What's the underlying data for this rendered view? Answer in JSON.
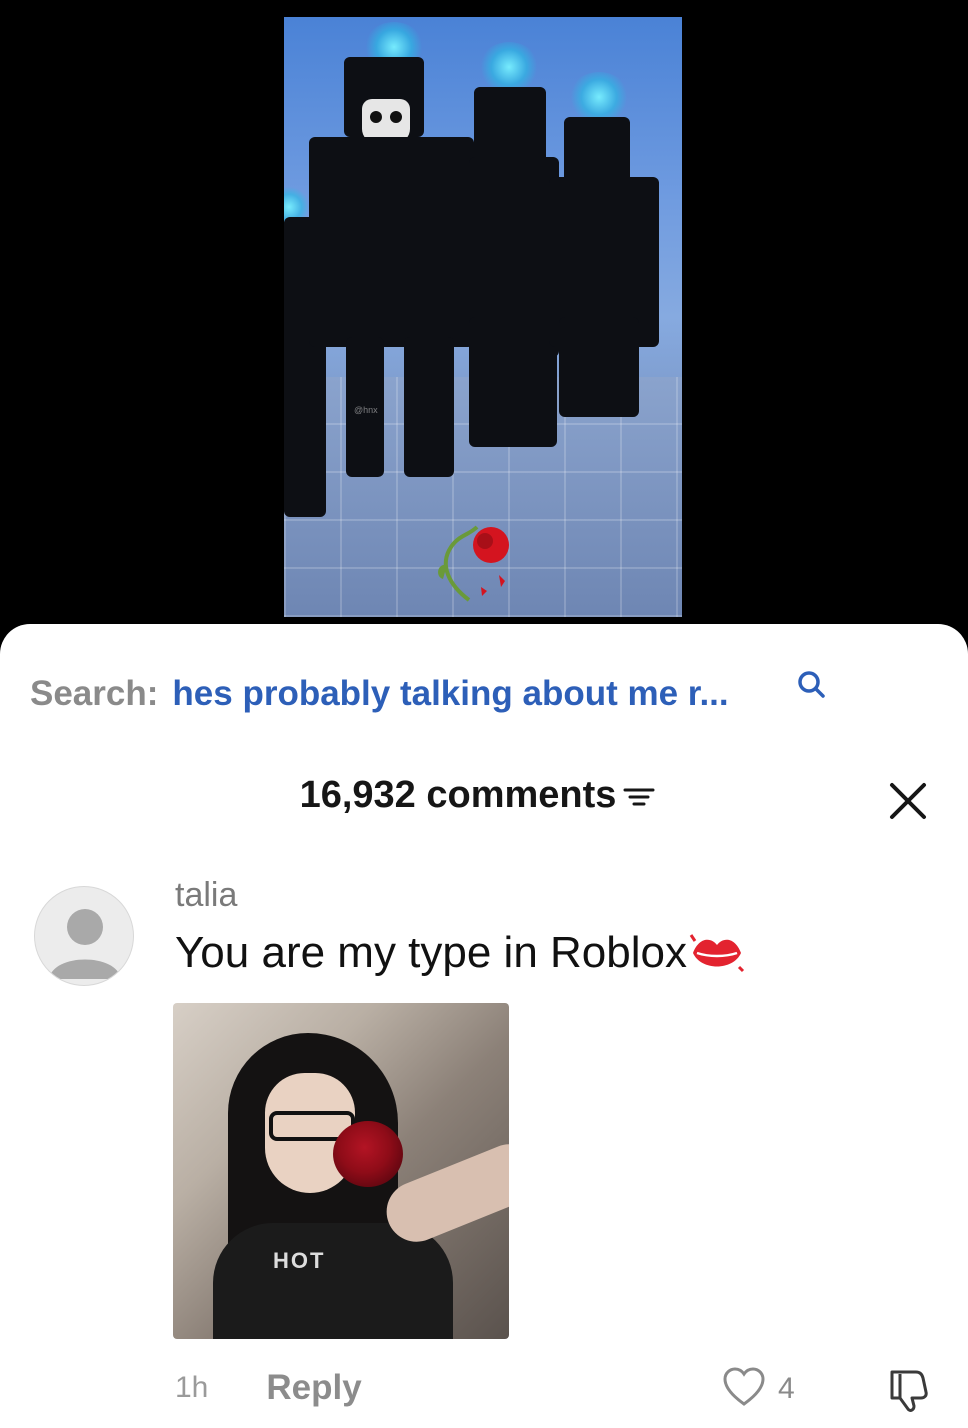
{
  "video": {
    "watermark": "@hnx",
    "icons": {
      "rose_overlay": "wilted-rose-icon"
    }
  },
  "search": {
    "label": "Search:",
    "query": "hes probably talking about me r...",
    "icon": "search-icon",
    "query_color": "#2d5fb8"
  },
  "comments": {
    "title": "16,932 comments",
    "filter_icon": "filter-icon",
    "close_icon": "close-icon"
  },
  "comment": {
    "username": "talia",
    "text": "You are my type in Roblox",
    "emoji": "lips-icon",
    "attachment_shirt_text": "HOT",
    "time": "1h",
    "reply_label": "Reply",
    "like_count": "4",
    "icons": {
      "avatar": "default-avatar-icon",
      "like": "heart-icon",
      "dislike": "thumbs-down-icon"
    }
  }
}
